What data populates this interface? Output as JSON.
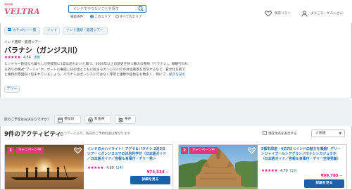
{
  "header": {
    "logo_badge": "現地体験",
    "logo_text": "VELTRA",
    "search_placeholder": "インドでやりたいことを探す",
    "scope_label": "検索条件：",
    "scope_options": [
      "このエリア",
      "すべてのエリア"
    ],
    "scope_selected": "このエリア",
    "favorites_label": "保存リスト",
    "user_label": "ようこそ、ゲストさん"
  },
  "breadcrumb": {
    "category_button": "カテゴリー一覧",
    "items": [
      "インド",
      "インド遺跡・厳選ツアー"
    ]
  },
  "main": {
    "subtitle": "インド遺跡・厳選ツアー",
    "title": "バラナシ（ガンジス川）",
    "rating_value": "4.54",
    "rating_count": "(68)",
    "description_line1": "ヒンドゥー教徒なら暮らしが完成前に1度は訪れたいと願う、5000年以上の歴史を持つ最大の聖地『バラナシ』。毎朝行われ",
    "description_line2": "る祈りの儀式“プージャ”や、ボートに乗船し日の出とともに始まるガンジス川での沐浴風景を見学するなど、貴文化を肌で",
    "description_line3": "と独特の雰囲気に包まれていましょう。バラナシはガンジス川ではなく寺院と鐘楼や宿坊をも数多く、特にプ…",
    "description_more": "続きを読む",
    "tag": "デリー"
  },
  "filters": {
    "question": "旅のご予定はお決まりですか？",
    "buttons": [
      {
        "label": "参加日",
        "icon": "calendar-icon"
      },
      {
        "label": "料金帯",
        "icon": "yen-icon"
      },
      {
        "label": "条件",
        "icon": "filter-icon"
      }
    ]
  },
  "results": {
    "title": "9件のアクティビティ",
    "note": "ツアーにより、各日のご予約料金は異なります",
    "map_toggle_label": "現在地点を表示する",
    "sort_value": "人気順"
  },
  "cards": [
    {
      "rank": "1",
      "campaign": "キャンペーン中",
      "title": "インドの大ハイライト！アグラ＆バラナシ 2泊3日ツアー＜ガンジス川での沐浴見学付（日本語ガイド／日本語ガイド／官報＆食事付・デリー発＞",
      "rating_value": "4.60",
      "rating_count": "(24)",
      "price": "¥73,534",
      "cta": "詳細を見る"
    },
    {
      "rank": "2",
      "campaign": "キャンペーン中",
      "title": "5都市周遊・4泊7日＜インドの魅力を凝縮！デリー＞ジャイプール＞アグラ＞バラナシ＞カジュラホ〈日本語ガイド／官報＆食事付・デリー空港発着〉",
      "rating_value": "4.70",
      "rating_count": "(10)",
      "price": "¥99,785",
      "cta": "詳細を見る"
    }
  ],
  "colors": {
    "brand_pink": "#e4007f",
    "link_blue": "#1d6bb1",
    "cta_blue": "#1d5fa8",
    "badge_pink": "#e4377b"
  }
}
